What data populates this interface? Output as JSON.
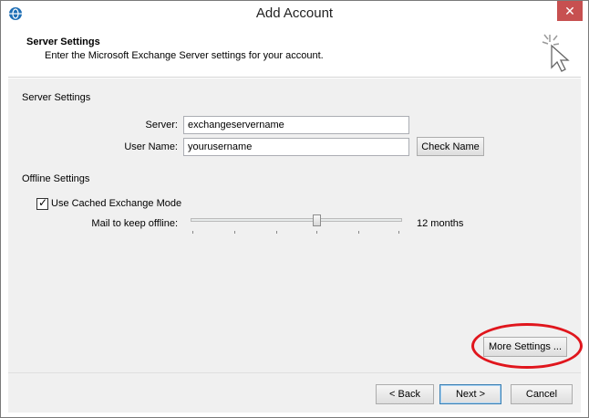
{
  "window": {
    "title": "Add Account"
  },
  "header": {
    "title": "Server Settings",
    "subtitle": "Enter the Microsoft Exchange Server settings for your account."
  },
  "server_settings": {
    "section_label": "Server Settings",
    "server_label": "Server:",
    "server_value": "exchangeservername",
    "username_label": "User Name:",
    "username_value": "yourusername",
    "check_name_label": "Check Name"
  },
  "offline_settings": {
    "section_label": "Offline Settings",
    "cached_mode_label": "Use Cached Exchange Mode",
    "cached_mode_checked": true,
    "mail_offline_label": "Mail to keep offline:",
    "mail_offline_value": "12 months",
    "slider_fraction": 0.6
  },
  "more_settings_label": "More Settings ...",
  "footer": {
    "back_label": "< Back",
    "next_label": "Next >",
    "cancel_label": "Cancel"
  },
  "colors": {
    "highlight": "#e0161d",
    "close_button": "#c75050",
    "dialog_background": "#f0f0f0"
  }
}
